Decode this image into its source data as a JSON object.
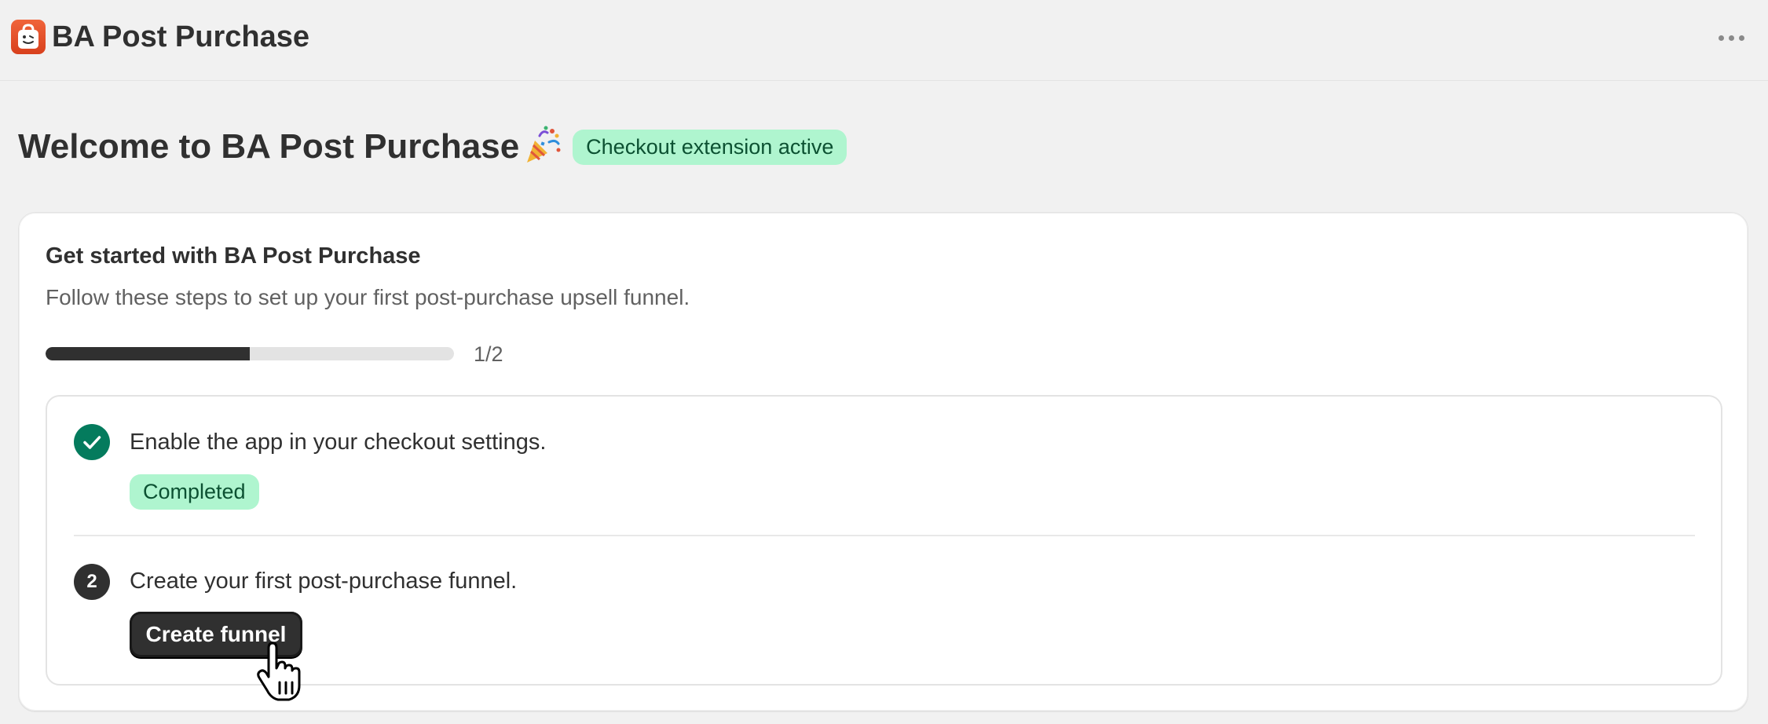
{
  "app": {
    "title": "BA Post Purchase",
    "logo_icon": "shopping-bag-logo-icon",
    "more_icon": "more-horizontal-icon"
  },
  "page": {
    "title": "Welcome to BA Post Purchase",
    "title_emoji_icon": "party-popper-icon",
    "status_badge": "Checkout extension active"
  },
  "card": {
    "title": "Get started with BA Post Purchase",
    "subtitle": "Follow these steps to set up your first post-purchase upsell funnel.",
    "progress": {
      "completed": 1,
      "total": 2,
      "label": "1/2"
    },
    "steps": [
      {
        "number": "1",
        "state": "complete",
        "text": "Enable the app in your checkout settings.",
        "badge": "Completed"
      },
      {
        "number": "2",
        "state": "pending",
        "text": "Create your first post-purchase funnel.",
        "button_label": "Create funnel"
      }
    ]
  },
  "colors": {
    "background": "#f1f1f1",
    "badge_bg": "#aff5cf",
    "badge_text": "#0c5132",
    "check_green": "#047b5d",
    "primary_button": "#303030",
    "logo_orange": "#e5532a"
  }
}
